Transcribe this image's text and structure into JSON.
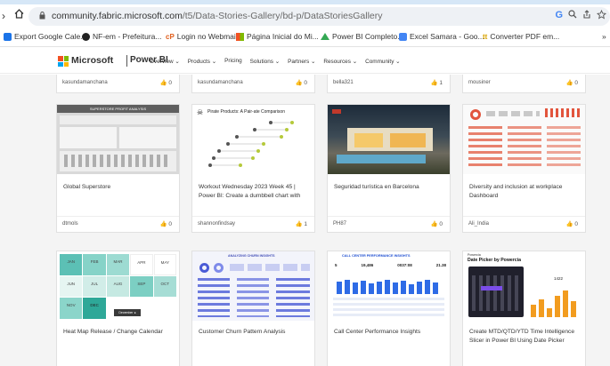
{
  "browser": {
    "url_host": "community.fabric.microsoft.com",
    "url_path": "/t5/Data-Stories-Gallery/bd-p/DataStoriesGallery",
    "google_icon": "G"
  },
  "bookmarks": [
    {
      "label": "Export Google Cale...",
      "icon": "calendar-icon",
      "color": "#1a73e8"
    },
    {
      "label": "NF-em - Prefeitura...",
      "icon": "github-icon",
      "color": "#222222"
    },
    {
      "label": "Login no Webmail",
      "icon": "cp-icon",
      "color": "#e05d1a"
    },
    {
      "label": "Página Inicial do Mi...",
      "icon": "microsoft-icon",
      "color": "#f25022"
    },
    {
      "label": "Power BI Completo...",
      "icon": "drive-icon",
      "color": "#34a853"
    },
    {
      "label": "Excel Samara - Goo...",
      "icon": "sheets-icon",
      "color": "#4285f4"
    },
    {
      "label": "Converter PDF em...",
      "icon": "pdf-icon",
      "color": "#d9a400"
    }
  ],
  "site_nav": {
    "brand": "Microsoft",
    "product": "Power BI",
    "items": [
      "Overview ⌄",
      "Products ⌄",
      "Pricing",
      "Solutions ⌄",
      "Partners ⌄",
      "Resources ⌄",
      "Community ⌄"
    ]
  },
  "gallery": {
    "row0": [
      {
        "author": "kasundamanchana",
        "likes": "0"
      },
      {
        "author": "kasundamanchana",
        "likes": "0"
      },
      {
        "author": "bella321",
        "likes": "1"
      },
      {
        "author": "mousiner",
        "likes": "0"
      }
    ],
    "row1": [
      {
        "title": "Global Superstore",
        "author": "dtmols",
        "likes": "0",
        "thumb_heading": "SUPERSTORE PROFIT ANALYSIS"
      },
      {
        "title": "Workout Wednesday 2023 Week 45 | Power BI: Create a dumbbell chart with",
        "author": "shannonfindsay",
        "likes": "1",
        "thumb_heading": "Pirate Products: A Pair-ate Comparison"
      },
      {
        "title": "Seguridad turística en Barcelona",
        "author": "PH87",
        "likes": "0"
      },
      {
        "title": "Diversity and inclusion at workplace Dashboard",
        "author": "Ali_India",
        "likes": "0"
      }
    ],
    "row2": [
      {
        "title": "Heat Map Release / Change Calendar",
        "months": [
          "JAN",
          "FEB",
          "MAR",
          "APR",
          "MAY",
          "JUN",
          "JUL",
          "AUG",
          "SEP",
          "OCT",
          "NOV",
          "DEC"
        ],
        "tooltip": "December  ●"
      },
      {
        "title": "Customer Churn Pattern Analysis",
        "thumb_heading": "ANALYZING CHURN INSIGHTS"
      },
      {
        "title": "Call Center Performance Insights",
        "thumb_heading": "CALL CENTER PERFORMANCE INSIGHTS",
        "kpis": [
          "5",
          "19,486",
          "0037:08",
          "21.38"
        ]
      },
      {
        "title": "Create MTD/QTD/YTD Time Intelligence Slicer in Power BI Using Date Picker",
        "thumb_heading": "Date Picker by Powercia",
        "brand": "Powercia",
        "kpi": "1422"
      }
    ]
  },
  "like_icon": "thumbs-up-icon"
}
